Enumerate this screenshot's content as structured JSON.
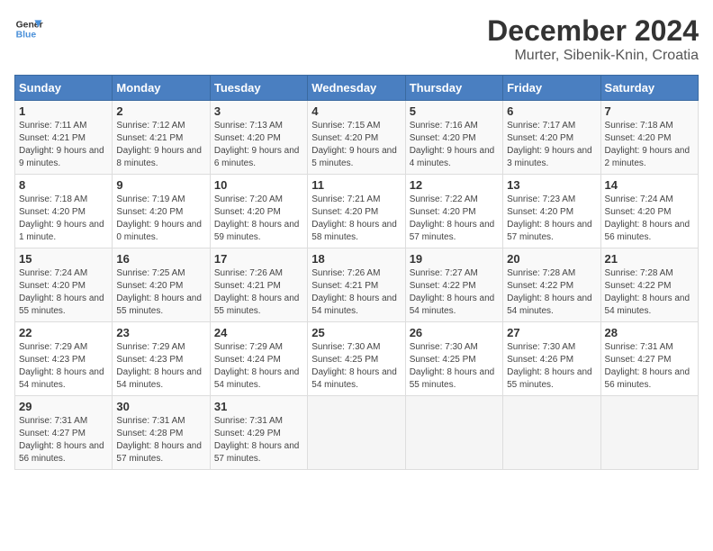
{
  "header": {
    "logo_line1": "General",
    "logo_line2": "Blue",
    "title": "December 2024",
    "subtitle": "Murter, Sibenik-Knin, Croatia"
  },
  "days_of_week": [
    "Sunday",
    "Monday",
    "Tuesday",
    "Wednesday",
    "Thursday",
    "Friday",
    "Saturday"
  ],
  "weeks": [
    [
      {
        "day": "1",
        "sunrise": "7:11 AM",
        "sunset": "4:21 PM",
        "daylight": "9 hours and 9 minutes."
      },
      {
        "day": "2",
        "sunrise": "7:12 AM",
        "sunset": "4:21 PM",
        "daylight": "9 hours and 8 minutes."
      },
      {
        "day": "3",
        "sunrise": "7:13 AM",
        "sunset": "4:20 PM",
        "daylight": "9 hours and 6 minutes."
      },
      {
        "day": "4",
        "sunrise": "7:15 AM",
        "sunset": "4:20 PM",
        "daylight": "9 hours and 5 minutes."
      },
      {
        "day": "5",
        "sunrise": "7:16 AM",
        "sunset": "4:20 PM",
        "daylight": "9 hours and 4 minutes."
      },
      {
        "day": "6",
        "sunrise": "7:17 AM",
        "sunset": "4:20 PM",
        "daylight": "9 hours and 3 minutes."
      },
      {
        "day": "7",
        "sunrise": "7:18 AM",
        "sunset": "4:20 PM",
        "daylight": "9 hours and 2 minutes."
      }
    ],
    [
      {
        "day": "8",
        "sunrise": "7:18 AM",
        "sunset": "4:20 PM",
        "daylight": "9 hours and 1 minute."
      },
      {
        "day": "9",
        "sunrise": "7:19 AM",
        "sunset": "4:20 PM",
        "daylight": "9 hours and 0 minutes."
      },
      {
        "day": "10",
        "sunrise": "7:20 AM",
        "sunset": "4:20 PM",
        "daylight": "8 hours and 59 minutes."
      },
      {
        "day": "11",
        "sunrise": "7:21 AM",
        "sunset": "4:20 PM",
        "daylight": "8 hours and 58 minutes."
      },
      {
        "day": "12",
        "sunrise": "7:22 AM",
        "sunset": "4:20 PM",
        "daylight": "8 hours and 57 minutes."
      },
      {
        "day": "13",
        "sunrise": "7:23 AM",
        "sunset": "4:20 PM",
        "daylight": "8 hours and 57 minutes."
      },
      {
        "day": "14",
        "sunrise": "7:24 AM",
        "sunset": "4:20 PM",
        "daylight": "8 hours and 56 minutes."
      }
    ],
    [
      {
        "day": "15",
        "sunrise": "7:24 AM",
        "sunset": "4:20 PM",
        "daylight": "8 hours and 55 minutes."
      },
      {
        "day": "16",
        "sunrise": "7:25 AM",
        "sunset": "4:20 PM",
        "daylight": "8 hours and 55 minutes."
      },
      {
        "day": "17",
        "sunrise": "7:26 AM",
        "sunset": "4:21 PM",
        "daylight": "8 hours and 55 minutes."
      },
      {
        "day": "18",
        "sunrise": "7:26 AM",
        "sunset": "4:21 PM",
        "daylight": "8 hours and 54 minutes."
      },
      {
        "day": "19",
        "sunrise": "7:27 AM",
        "sunset": "4:22 PM",
        "daylight": "8 hours and 54 minutes."
      },
      {
        "day": "20",
        "sunrise": "7:28 AM",
        "sunset": "4:22 PM",
        "daylight": "8 hours and 54 minutes."
      },
      {
        "day": "21",
        "sunrise": "7:28 AM",
        "sunset": "4:22 PM",
        "daylight": "8 hours and 54 minutes."
      }
    ],
    [
      {
        "day": "22",
        "sunrise": "7:29 AM",
        "sunset": "4:23 PM",
        "daylight": "8 hours and 54 minutes."
      },
      {
        "day": "23",
        "sunrise": "7:29 AM",
        "sunset": "4:23 PM",
        "daylight": "8 hours and 54 minutes."
      },
      {
        "day": "24",
        "sunrise": "7:29 AM",
        "sunset": "4:24 PM",
        "daylight": "8 hours and 54 minutes."
      },
      {
        "day": "25",
        "sunrise": "7:30 AM",
        "sunset": "4:25 PM",
        "daylight": "8 hours and 54 minutes."
      },
      {
        "day": "26",
        "sunrise": "7:30 AM",
        "sunset": "4:25 PM",
        "daylight": "8 hours and 55 minutes."
      },
      {
        "day": "27",
        "sunrise": "7:30 AM",
        "sunset": "4:26 PM",
        "daylight": "8 hours and 55 minutes."
      },
      {
        "day": "28",
        "sunrise": "7:31 AM",
        "sunset": "4:27 PM",
        "daylight": "8 hours and 56 minutes."
      }
    ],
    [
      {
        "day": "29",
        "sunrise": "7:31 AM",
        "sunset": "4:27 PM",
        "daylight": "8 hours and 56 minutes."
      },
      {
        "day": "30",
        "sunrise": "7:31 AM",
        "sunset": "4:28 PM",
        "daylight": "8 hours and 57 minutes."
      },
      {
        "day": "31",
        "sunrise": "7:31 AM",
        "sunset": "4:29 PM",
        "daylight": "8 hours and 57 minutes."
      },
      null,
      null,
      null,
      null
    ]
  ],
  "labels": {
    "sunrise": "Sunrise:",
    "sunset": "Sunset:",
    "daylight": "Daylight:"
  }
}
